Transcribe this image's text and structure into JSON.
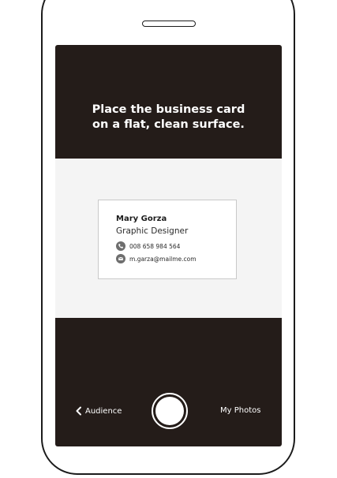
{
  "instruction": {
    "line1": "Place the business card",
    "line2": "on a flat, clean surface."
  },
  "card": {
    "name": "Mary Gorza",
    "title": "Graphic Designer",
    "phone": "008 658 984 564",
    "email": "m.garza@mailme.com",
    "phone_icon": "phone-icon",
    "email_icon": "mail-icon"
  },
  "bottom_bar": {
    "back_label": "Audience",
    "back_icon": "chevron-left-icon",
    "photos_label": "My Photos",
    "shutter_icon": "shutter-button"
  },
  "colors": {
    "screen_background": "#241c19",
    "viewfinder_background": "#f4f4f4",
    "text_on_dark": "#ffffff"
  }
}
